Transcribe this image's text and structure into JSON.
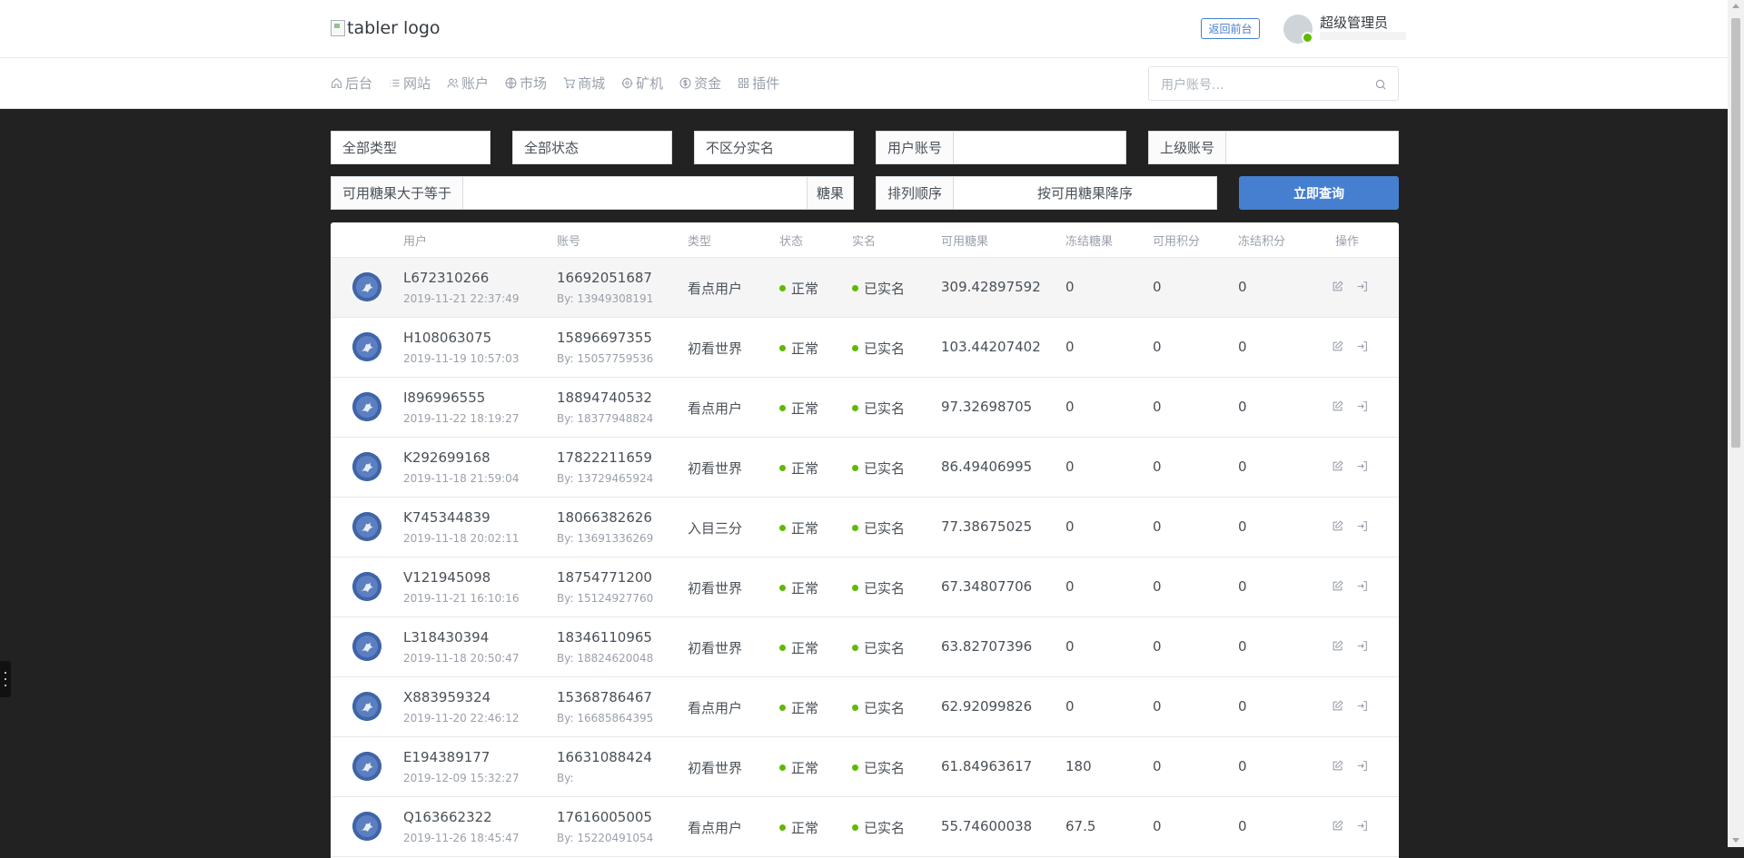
{
  "header": {
    "logo_alt": "tabler logo",
    "back_button": "返回前台",
    "admin_name": "超级管理员"
  },
  "nav": {
    "items": [
      {
        "label": "后台",
        "icon": "home-icon"
      },
      {
        "label": "网站",
        "icon": "list-icon"
      },
      {
        "label": "账户",
        "icon": "users-icon"
      },
      {
        "label": "市场",
        "icon": "globe-icon"
      },
      {
        "label": "商城",
        "icon": "cart-icon"
      },
      {
        "label": "矿机",
        "icon": "settings-icon"
      },
      {
        "label": "资金",
        "icon": "dollar-icon"
      },
      {
        "label": "插件",
        "icon": "grid-icon"
      }
    ],
    "search_placeholder": "用户账号..."
  },
  "filters": {
    "type_select": "全部类型",
    "status_select": "全部状态",
    "realname_select": "不区分实名",
    "user_account_label": "用户账号",
    "parent_account_label": "上级账号",
    "candy_min_label": "可用糖果大于等于",
    "candy_suffix": "糖果",
    "sort_label": "排列顺序",
    "sort_value": "按可用糖果降序",
    "query_button": "立即查询"
  },
  "table": {
    "columns": [
      "用户",
      "账号",
      "类型",
      "状态",
      "实名",
      "可用糖果",
      "冻结糖果",
      "可用积分",
      "冻结积分",
      "操作"
    ],
    "rows": [
      {
        "user": "L672310266",
        "time": "2019-11-21 22:37:49",
        "account": "16692051687",
        "by": "By: 13949308191",
        "type": "看点用户",
        "status": "正常",
        "realname": "已实名",
        "candy": "309.42897592",
        "frozen_candy": "0",
        "points": "0",
        "frozen_points": "0"
      },
      {
        "user": "H108063075",
        "time": "2019-11-19 10:57:03",
        "account": "15896697355",
        "by": "By: 15057759536",
        "type": "初看世界",
        "status": "正常",
        "realname": "已实名",
        "candy": "103.44207402",
        "frozen_candy": "0",
        "points": "0",
        "frozen_points": "0"
      },
      {
        "user": "I896996555",
        "time": "2019-11-22 18:19:27",
        "account": "18894740532",
        "by": "By: 18377948824",
        "type": "看点用户",
        "status": "正常",
        "realname": "已实名",
        "candy": "97.32698705",
        "frozen_candy": "0",
        "points": "0",
        "frozen_points": "0"
      },
      {
        "user": "K292699168",
        "time": "2019-11-18 21:59:04",
        "account": "17822211659",
        "by": "By: 13729465924",
        "type": "初看世界",
        "status": "正常",
        "realname": "已实名",
        "candy": "86.49406995",
        "frozen_candy": "0",
        "points": "0",
        "frozen_points": "0"
      },
      {
        "user": "K745344839",
        "time": "2019-11-18 20:02:11",
        "account": "18066382626",
        "by": "By: 13691336269",
        "type": "入目三分",
        "status": "正常",
        "realname": "已实名",
        "candy": "77.38675025",
        "frozen_candy": "0",
        "points": "0",
        "frozen_points": "0"
      },
      {
        "user": "V121945098",
        "time": "2019-11-21 16:10:16",
        "account": "18754771200",
        "by": "By: 15124927760",
        "type": "初看世界",
        "status": "正常",
        "realname": "已实名",
        "candy": "67.34807706",
        "frozen_candy": "0",
        "points": "0",
        "frozen_points": "0"
      },
      {
        "user": "L318430394",
        "time": "2019-11-18 20:50:47",
        "account": "18346110965",
        "by": "By: 18824620048",
        "type": "初看世界",
        "status": "正常",
        "realname": "已实名",
        "candy": "63.82707396",
        "frozen_candy": "0",
        "points": "0",
        "frozen_points": "0"
      },
      {
        "user": "X883959324",
        "time": "2019-11-20 22:46:12",
        "account": "15368786467",
        "by": "By: 16685864395",
        "type": "看点用户",
        "status": "正常",
        "realname": "已实名",
        "candy": "62.92099826",
        "frozen_candy": "0",
        "points": "0",
        "frozen_points": "0"
      },
      {
        "user": "E194389177",
        "time": "2019-12-09 15:32:27",
        "account": "16631088424",
        "by": "By:",
        "type": "初看世界",
        "status": "正常",
        "realname": "已实名",
        "candy": "61.84963617",
        "frozen_candy": "180",
        "points": "0",
        "frozen_points": "0"
      },
      {
        "user": "Q163662322",
        "time": "2019-11-26 18:45:47",
        "account": "17616005005",
        "by": "By: 15220491054",
        "type": "看点用户",
        "status": "正常",
        "realname": "已实名",
        "candy": "55.74600038",
        "frozen_candy": "67.5",
        "points": "0",
        "frozen_points": "0"
      }
    ]
  },
  "colors": {
    "primary": "#467fcf",
    "status_green": "#5eba00",
    "page_bg": "#222222"
  }
}
